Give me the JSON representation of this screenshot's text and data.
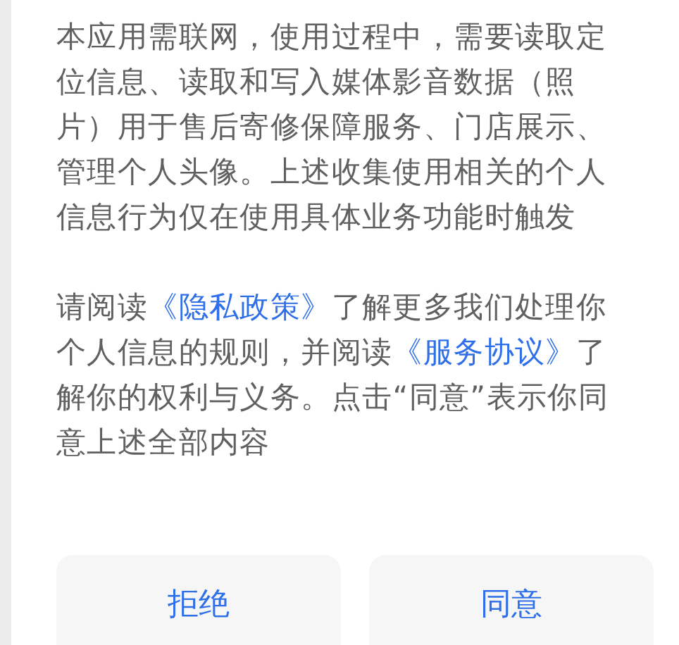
{
  "intro_text": "本应用需联网，使用过程中，需要读取定位信息、读取和写入媒体影音数据（照片）用于售后寄修保障服务、门店展示、管理个人头像。上述收集使用相关的个人信息行为仅在使用具体业务功能时触发",
  "consent_text": [
    {
      "kind": "text",
      "text": "请阅读"
    },
    {
      "kind": "link",
      "text": "《隐私政策》"
    },
    {
      "kind": "text",
      "text": "了解更多我们处理你个人信息的规则，并阅读"
    },
    {
      "kind": "link",
      "text": "《服务协议》"
    },
    {
      "kind": "text",
      "text": "了解你的权利与义务。点击“同意”表示你同意上述全部内容"
    }
  ],
  "buttons": [
    {
      "label": "拒绝"
    },
    {
      "label": "同意"
    }
  ]
}
